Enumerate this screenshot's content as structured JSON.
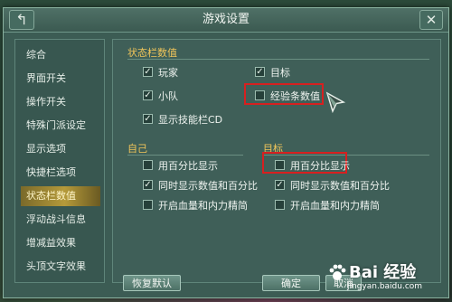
{
  "window": {
    "title": "游戏设置",
    "back_symbol": "↰",
    "close_symbol": "✕"
  },
  "sidebar": {
    "items": [
      {
        "label": "综合",
        "active": false
      },
      {
        "label": "界面开关",
        "active": false
      },
      {
        "label": "操作开关",
        "active": false
      },
      {
        "label": "特殊门派设定",
        "active": false
      },
      {
        "label": "显示选项",
        "active": false
      },
      {
        "label": "快捷栏选项",
        "active": false
      },
      {
        "label": "状态栏数值",
        "active": true
      },
      {
        "label": "浮动战斗信息",
        "active": false
      },
      {
        "label": "增减益效果",
        "active": false
      },
      {
        "label": "头顶文字效果",
        "active": false
      }
    ]
  },
  "status_bar": {
    "title": "状态栏数值",
    "options": [
      {
        "label": "玩家",
        "checked": true
      },
      {
        "label": "目标",
        "checked": true
      },
      {
        "label": "小队",
        "checked": true
      },
      {
        "label": "经验条数值",
        "checked": false
      },
      {
        "label": "显示技能栏CD",
        "checked": true
      }
    ]
  },
  "self": {
    "title": "自己",
    "options": [
      {
        "label": "用百分比显示",
        "checked": false
      },
      {
        "label": "同时显示数值和百分比",
        "checked": true
      },
      {
        "label": "开启血量和内力精简",
        "checked": false
      }
    ]
  },
  "target": {
    "title": "目标",
    "options": [
      {
        "label": "用百分比显示",
        "checked": false
      },
      {
        "label": "同时显示数值和百分比",
        "checked": true
      },
      {
        "label": "开启血量和内力精简",
        "checked": false
      }
    ]
  },
  "footer": {
    "restore_label": "恢复默认",
    "ok_label": "确定",
    "cancel_label": "取消"
  },
  "watermark": {
    "text": "Bai 经验",
    "url": "jingyan.baidu.com"
  },
  "colors": {
    "accent": "#f0c55a",
    "highlight_box": "#d72020",
    "active_tab": "#b59a3a"
  }
}
